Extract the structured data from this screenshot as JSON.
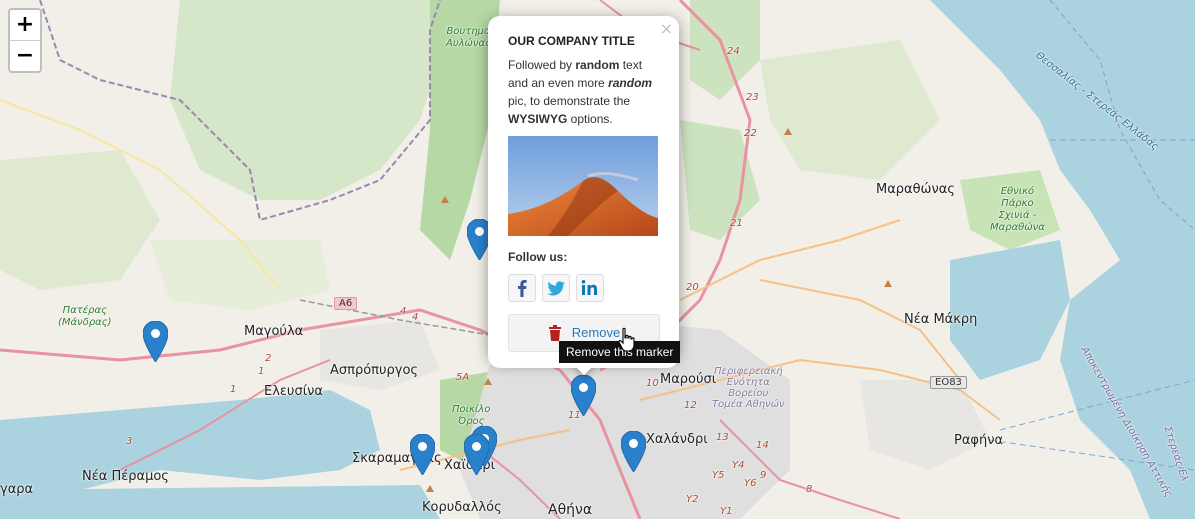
{
  "zoom": {
    "in_label": "+",
    "out_label": "−"
  },
  "popup": {
    "close": "×",
    "title": "OUR COMPANY TITLE",
    "body": {
      "t1": "Followed by ",
      "b1": "random",
      "t2": " text and an even more ",
      "bi": "random",
      "t3": " pic, to demonstrate the ",
      "b2": "WYSIWYG",
      "t4": " options."
    },
    "follow_label": "Follow us:",
    "social": [
      "facebook-icon",
      "twitter-icon",
      "linkedin-icon"
    ],
    "remove_label": "Remove"
  },
  "tooltip": "Remove this marker",
  "map_labels": {
    "magoula": "Μαγούλα",
    "aspropyrgos": "Ασπρόπυργος",
    "elefsina": "Ελευσίνα",
    "nea_peramos": "Νέα Πέραμος",
    "gara": "γαρα",
    "skaramangas": "Σκαραμαγκάς",
    "chaidari": "Χαϊδάρι",
    "korydallos": "Κορυδαλλός",
    "athina": "Αθήνα",
    "marousi": "Μαρούσι",
    "chalandri": "Χαλάνδρι",
    "marathonas": "Μαραθώνας",
    "nea_makri": "Νέα Μάκρη",
    "rafina": "Ραφήνα",
    "pateras": "Πατέρας\n(Μάνδρας)",
    "voutiama": "Βουτημα\nΑυλώνας",
    "poikilo": "Ποικίλο\nΌρος",
    "ethniko_parko": "Εθνικό\nΠάρκο\nΣχινιά -\nΜαραθώνα",
    "perifereiaki": "Περιφερειακή\nΕνότητα\nΒορείου\nΤομέα Αθηνών",
    "sea_thessalias": "Θεσσαλίας - Στερεάς Ελλάδας",
    "sea_apokentromeni": "Αποκεντρωμένη Διοίκηση Αττικής",
    "sea_sterea": "Στερεάς Ελ"
  },
  "road_shields": {
    "a6": "A6",
    "eo83": "EO83"
  },
  "road_numbers": [
    "24",
    "23",
    "22",
    "21",
    "20",
    "4",
    "4",
    "5A",
    "2",
    "1",
    "1",
    "3",
    "10",
    "11",
    "12",
    "13",
    "14",
    "9",
    "8",
    "Y4",
    "Y5",
    "Y6",
    "Y1",
    "Y2"
  ],
  "colors": {
    "marker": "#2a81cb",
    "water": "#aad3df",
    "forest": "#add19e",
    "urban": "#e0dfdf",
    "remove_text": "#2a7ab8",
    "trash": "#b22222"
  }
}
